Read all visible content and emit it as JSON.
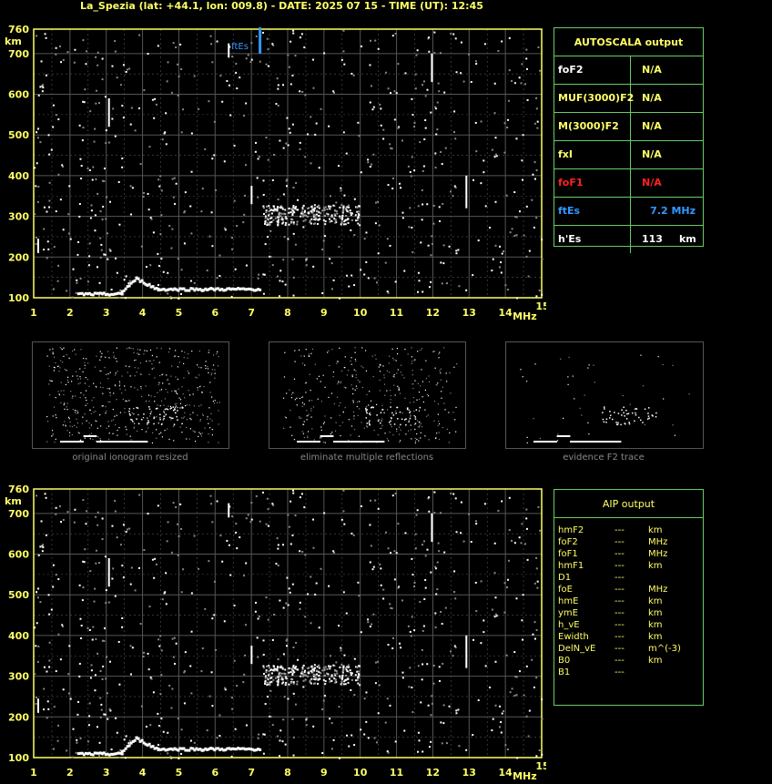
{
  "header": {
    "title": "La_Spezia (lat: +44.1, lon: 009.8) - DATE: 2025 07 15 - TIME (UT): 12:45"
  },
  "plot": {
    "y_unit": "km",
    "x_unit": "MHz",
    "y_ticks": [
      "760",
      "700",
      "600",
      "500",
      "400",
      "300",
      "200",
      "100"
    ],
    "x_ticks": [
      "1",
      "2",
      "3",
      "4",
      "5",
      "6",
      "7",
      "8",
      "9",
      "10",
      "11",
      "12",
      "13",
      "14",
      "15"
    ],
    "ftes_marker_label": "ftEs",
    "ftes_marker_freq": 7.2
  },
  "autoscala": {
    "title": "AUTOSCALA output",
    "rows": [
      {
        "label": "foF2",
        "value": "N/A",
        "unit": "",
        "color": "#ffffff",
        "vcolor": "#ffff66"
      },
      {
        "label": "MUF(3000)F2",
        "value": "N/A",
        "unit": "",
        "color": "#ffff66",
        "vcolor": "#ffff66"
      },
      {
        "label": "M(3000)F2",
        "value": "N/A",
        "unit": "",
        "color": "#ffff66",
        "vcolor": "#ffff66"
      },
      {
        "label": "fxI",
        "value": "N/A",
        "unit": "",
        "color": "#ffff66",
        "vcolor": "#ffff66"
      },
      {
        "label": "foF1",
        "value": "N/A",
        "unit": "",
        "color": "#ff2222",
        "vcolor": "#ff2222"
      },
      {
        "label": "ftEs",
        "value": "7.2 MHz",
        "unit": "",
        "color": "#3399ff",
        "vcolor": "#3399ff"
      },
      {
        "label": "h'Es",
        "value": "113",
        "unit": "km",
        "color": "#ffffff",
        "vcolor": "#ffffff"
      }
    ]
  },
  "thumbnails": [
    {
      "caption": "original ionogram resized"
    },
    {
      "caption": "eliminate multiple reflections"
    },
    {
      "caption": "evidence F2 trace"
    }
  ],
  "aip": {
    "title": "AIP output",
    "rows": [
      {
        "label": "hmF2",
        "value": "---",
        "unit": "km"
      },
      {
        "label": "foF2",
        "value": "---",
        "unit": "MHz"
      },
      {
        "label": "foF1",
        "value": "---",
        "unit": "MHz"
      },
      {
        "label": "hmF1",
        "value": "---",
        "unit": "km"
      },
      {
        "label": "D1",
        "value": "---",
        "unit": ""
      },
      {
        "label": "foE",
        "value": "---",
        "unit": "MHz"
      },
      {
        "label": "hmE",
        "value": "---",
        "unit": "km"
      },
      {
        "label": "ymE",
        "value": "---",
        "unit": "km"
      },
      {
        "label": "h_vE",
        "value": "---",
        "unit": "km"
      },
      {
        "label": "Ewidth",
        "value": "---",
        "unit": "km"
      },
      {
        "label": "DelN_vE",
        "value": "---",
        "unit": "m^(-3)"
      },
      {
        "label": "B0",
        "value": "---",
        "unit": "km"
      },
      {
        "label": "B1",
        "value": "---",
        "unit": ""
      }
    ]
  },
  "colors": {
    "grid": "#555555",
    "axis": "#ffff66",
    "panel_border": "#66cc66",
    "ftes": "#3399ff"
  }
}
